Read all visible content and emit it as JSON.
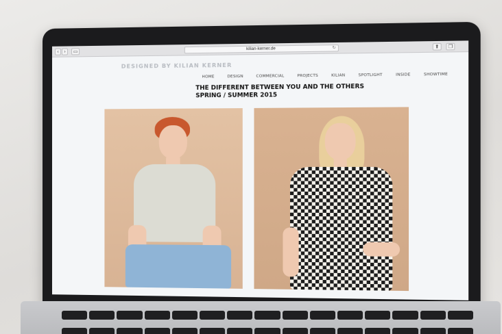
{
  "browser": {
    "url": "kilian-kerner.de",
    "reload_icon": "↻",
    "back_icon": "‹",
    "forward_icon": "›",
    "sidebar_icon": "▭",
    "share_icon": "⬆",
    "tabs_icon": "❐"
  },
  "site": {
    "logo": "DESIGNED BY KILIAN KERNER",
    "nav": [
      "HOME",
      "DESIGN",
      "COMMERCIAL",
      "PROJECTS",
      "KILIAN",
      "SPOTLIGHT",
      "INSIDE",
      "SHOWTIME"
    ],
    "headline_line1": "THE DIFFERENT BETWEEN YOU AND THE OTHERS",
    "headline_line2": "SPRING / SUMMER 2015"
  }
}
